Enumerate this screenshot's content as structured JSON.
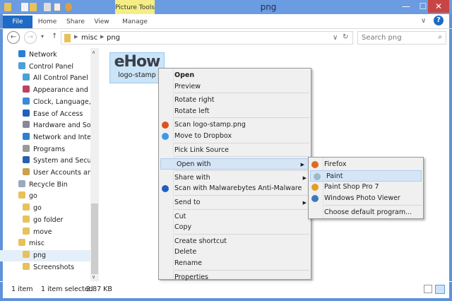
{
  "window": {
    "title": "png",
    "context_tab": "Picture Tools",
    "minimize": "—",
    "maximize": "☐",
    "close": "✕"
  },
  "ribbon": {
    "tabs": [
      "File",
      "Home",
      "Share",
      "View",
      "Manage"
    ],
    "expand": "∨",
    "help": "?"
  },
  "address": {
    "path": [
      "misc",
      "png"
    ],
    "search_placeholder": "Search png",
    "back": "←",
    "forward": "→",
    "up": "↑",
    "recent": "▾",
    "refresh": "↻",
    "dropdown": "∨",
    "search_icon": "⌕"
  },
  "sidebar": {
    "items": [
      {
        "label": "Network",
        "icon": "network-icon",
        "indent": 1
      },
      {
        "label": "Control Panel",
        "icon": "control-panel-icon",
        "indent": 1
      },
      {
        "label": "All Control Panel Items",
        "icon": "control-panel-icon",
        "indent": 2
      },
      {
        "label": "Appearance and Personalization",
        "icon": "appearance-icon",
        "indent": 2
      },
      {
        "label": "Clock, Language, and Region",
        "icon": "clock-icon",
        "indent": 2
      },
      {
        "label": "Ease of Access",
        "icon": "ease-icon",
        "indent": 2
      },
      {
        "label": "Hardware and Sound",
        "icon": "hardware-icon",
        "indent": 2
      },
      {
        "label": "Network and Internet",
        "icon": "network-icon",
        "indent": 2
      },
      {
        "label": "Programs",
        "icon": "programs-icon",
        "indent": 2
      },
      {
        "label": "System and Security",
        "icon": "system-icon",
        "indent": 2
      },
      {
        "label": "User Accounts and Family Safety",
        "icon": "users-icon",
        "indent": 2
      },
      {
        "label": "Recycle Bin",
        "icon": "recycle-bin-icon",
        "indent": 1
      },
      {
        "label": "go",
        "icon": "folder-icon",
        "indent": 1
      },
      {
        "label": "go",
        "icon": "folder-icon",
        "indent": 2
      },
      {
        "label": "go folder",
        "icon": "folder-icon",
        "indent": 2
      },
      {
        "label": "move",
        "icon": "folder-icon",
        "indent": 2
      },
      {
        "label": "misc",
        "icon": "folder-icon",
        "indent": 1
      },
      {
        "label": "png",
        "icon": "folder-icon",
        "indent": 2,
        "selected": true
      },
      {
        "label": "Screenshots",
        "icon": "folder-icon",
        "indent": 2
      }
    ]
  },
  "file": {
    "name": "logo-stamp",
    "thumb_text": "eHow"
  },
  "context_menu": {
    "items": [
      {
        "label": "Open",
        "bold": true
      },
      {
        "label": "Preview"
      },
      {
        "sep": true
      },
      {
        "label": "Rotate right"
      },
      {
        "label": "Rotate left"
      },
      {
        "sep": true
      },
      {
        "label": "Scan logo-stamp.png",
        "icon": "scan-icon"
      },
      {
        "label": "Move to Dropbox",
        "icon": "dropbox-icon"
      },
      {
        "sep": true
      },
      {
        "label": "Pick Link Source"
      },
      {
        "sep": true
      },
      {
        "label": "Open with",
        "submenu": true,
        "highlighted": true
      },
      {
        "sep": true
      },
      {
        "label": "Share with",
        "submenu": true
      },
      {
        "label": "Scan with Malwarebytes Anti-Malware",
        "icon": "malwarebytes-icon"
      },
      {
        "sep": true
      },
      {
        "label": "Send to",
        "submenu": true
      },
      {
        "sep": true
      },
      {
        "label": "Cut"
      },
      {
        "label": "Copy"
      },
      {
        "sep": true
      },
      {
        "label": "Create shortcut"
      },
      {
        "label": "Delete"
      },
      {
        "label": "Rename"
      },
      {
        "sep": true
      },
      {
        "label": "Properties"
      }
    ]
  },
  "submenu": {
    "items": [
      {
        "label": "Firefox",
        "icon": "firefox-icon"
      },
      {
        "label": "Paint",
        "icon": "paint-icon",
        "highlighted": true
      },
      {
        "label": "Paint Shop Pro 7",
        "icon": "paint-shop-pro-icon"
      },
      {
        "label": "Windows Photo Viewer",
        "icon": "photo-viewer-icon"
      },
      {
        "sep": true
      },
      {
        "label": "Choose default program..."
      }
    ]
  },
  "status": {
    "count": "1 item",
    "selected": "1 item selected",
    "size": "2.87 KB"
  },
  "colors": {
    "accent": "#1e6ac4",
    "titlebar": "#6b9be0",
    "close": "#c74545",
    "highlight": "#d6e5f5"
  }
}
